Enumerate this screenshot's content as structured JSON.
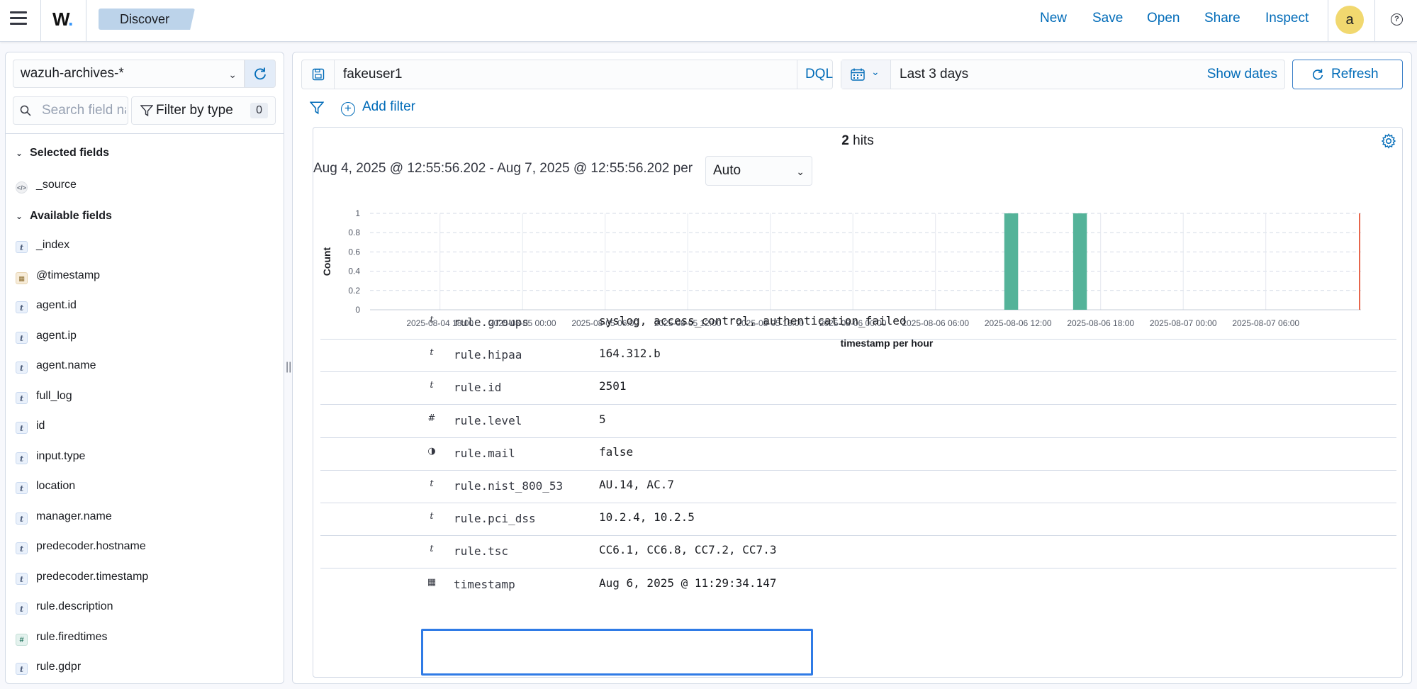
{
  "header": {
    "logo": "W",
    "app_tab": "Discover",
    "actions": [
      "New",
      "Save",
      "Open",
      "Share",
      "Inspect"
    ],
    "avatar_initial": "a",
    "icons": [
      "menu-icon",
      "help-icon"
    ]
  },
  "sidebar": {
    "index_pattern": "wazuh-archives-*",
    "search_placeholder": "Search field names",
    "filter_by_type_label": "Filter by type",
    "filter_count": "0",
    "selected_fields_label": "Selected fields",
    "selected_fields": [
      {
        "name": "_source",
        "type": "source"
      }
    ],
    "available_fields_label": "Available fields",
    "available_fields": [
      {
        "name": "_index",
        "type": "string"
      },
      {
        "name": "@timestamp",
        "type": "date"
      },
      {
        "name": "agent.id",
        "type": "string"
      },
      {
        "name": "agent.ip",
        "type": "string"
      },
      {
        "name": "agent.name",
        "type": "string"
      },
      {
        "name": "full_log",
        "type": "string"
      },
      {
        "name": "id",
        "type": "string"
      },
      {
        "name": "input.type",
        "type": "string"
      },
      {
        "name": "location",
        "type": "string"
      },
      {
        "name": "manager.name",
        "type": "string"
      },
      {
        "name": "predecoder.hostname",
        "type": "string"
      },
      {
        "name": "predecoder.timestamp",
        "type": "string"
      },
      {
        "name": "rule.description",
        "type": "string"
      },
      {
        "name": "rule.firedtimes",
        "type": "number"
      },
      {
        "name": "rule.gdpr",
        "type": "string"
      }
    ]
  },
  "query": {
    "value": "fakeuser1",
    "language": "DQL"
  },
  "datepicker": {
    "label": "Last 3 days",
    "show_dates": "Show dates",
    "refresh_label": "Refresh"
  },
  "filters": {
    "add_filter_label": "Add filter"
  },
  "results": {
    "hits_count": "2",
    "hits_suffix": "hits",
    "time_range": "Aug 4, 2025 @ 12:55:56.202 - Aug 7, 2025 @ 12:55:56.202 per",
    "interval": "Auto"
  },
  "chart_data": {
    "type": "bar",
    "xlabel": "timestamp per hour",
    "ylabel": "Count",
    "ylim": [
      0,
      1
    ],
    "y_ticks": [
      0,
      0.2,
      0.4,
      0.6,
      0.8,
      1
    ],
    "x_ticks": [
      "2025-08-04 18:00",
      "2025-08-05 00:00",
      "2025-08-05 06:00",
      "2025-08-05 12:00",
      "2025-08-05 18:00",
      "2025-08-06 00:00",
      "2025-08-06 06:00",
      "2025-08-06 12:00",
      "2025-08-06 18:00",
      "2025-08-07 00:00",
      "2025-08-07 06:00"
    ],
    "x_range": [
      "2025-08-04 12:55",
      "2025-08-07 12:55"
    ],
    "bars": [
      {
        "x": "2025-08-06 11:00",
        "value": 1
      },
      {
        "x": "2025-08-06 16:00",
        "value": 1
      }
    ],
    "now_marker": "2025-08-07 12:55",
    "bar_color": "#54b399",
    "now_color": "#e7664c",
    "grid": true
  },
  "document": {
    "rows": [
      {
        "name": "rule.groups",
        "type": "string",
        "value": "syslog, access_control, authentication_failed"
      },
      {
        "name": "rule.hipaa",
        "type": "string",
        "value": "164.312.b"
      },
      {
        "name": "rule.id",
        "type": "string",
        "value": "2501"
      },
      {
        "name": "rule.level",
        "type": "number",
        "value": "5"
      },
      {
        "name": "rule.mail",
        "type": "boolean",
        "value": "false"
      },
      {
        "name": "rule.nist_800_53",
        "type": "string",
        "value": "AU.14, AC.7"
      },
      {
        "name": "rule.pci_dss",
        "type": "string",
        "value": "10.2.4, 10.2.5"
      },
      {
        "name": "rule.tsc",
        "type": "string",
        "value": "CC6.1, CC6.8, CC7.2, CC7.3"
      },
      {
        "name": "timestamp",
        "type": "date",
        "value": "Aug 6, 2025 @ 11:29:34.147"
      }
    ]
  },
  "colors": {
    "link": "#006bb8",
    "highlight": "#2f7be6",
    "avatar": "#f1d86f"
  }
}
